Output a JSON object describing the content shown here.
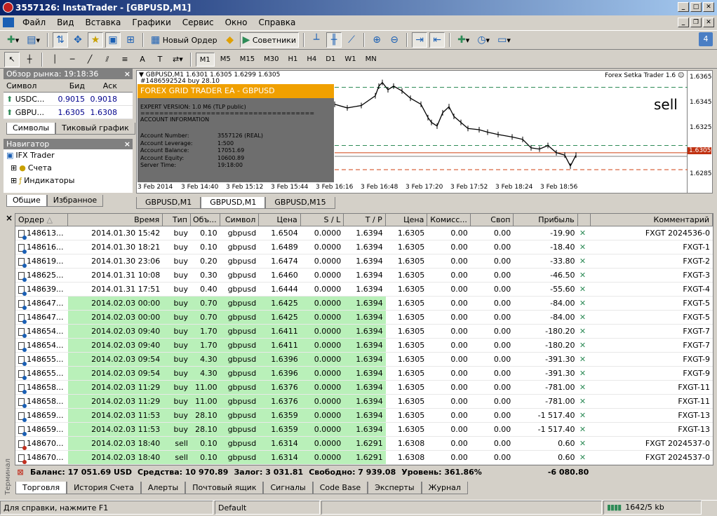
{
  "window": {
    "title": "3557126: InstaTrader - [GBPUSD,M1]"
  },
  "menu": [
    "Файл",
    "Вид",
    "Вставка",
    "Графики",
    "Сервис",
    "Окно",
    "Справка"
  ],
  "toolbar": {
    "new_order": "Новый Ордер",
    "advisors": "Советники"
  },
  "timeframes": [
    "M1",
    "M5",
    "M15",
    "M30",
    "H1",
    "H4",
    "D1",
    "W1",
    "MN"
  ],
  "market_watch": {
    "title": "Обзор рынка: 19:18:36",
    "headers": [
      "Символ",
      "Бид",
      "Аск"
    ],
    "rows": [
      {
        "symbol": "USDC...",
        "bid": "0.9015",
        "ask": "0.9018"
      },
      {
        "symbol": "GBPU...",
        "bid": "1.6305",
        "ask": "1.6308"
      }
    ],
    "tabs": [
      "Символы",
      "Тиковый график"
    ]
  },
  "navigator": {
    "title": "Навигатор",
    "items": [
      "IFX Trader",
      "Счета",
      "Индикаторы"
    ],
    "tabs": [
      "Общие",
      "Избранное"
    ]
  },
  "chart": {
    "header": "GBPUSD,M1  1.6301 1.6305 1.6299 1.6305",
    "order_label": "#1486592524 buy 28.10",
    "ea_name": "Forex Setka Trader 1.6",
    "signal": "sell",
    "price_ticks": [
      "1.6365",
      "1.6345",
      "1.6325",
      "1.6305",
      "1.6285"
    ],
    "current_price": "1.6305",
    "time_ticks": [
      "3 Feb 2014",
      "3 Feb 14:40",
      "3 Feb 15:12",
      "3 Feb 15:44",
      "3 Feb 16:16",
      "3 Feb 16:48",
      "3 Feb 17:20",
      "3 Feb 17:52",
      "3 Feb 18:24",
      "3 Feb 18:56"
    ],
    "overlay": {
      "title": "FOREX GRID TRADER EA - GBPUSD",
      "version": "EXPERT VERSION: 1.0 M6 (TLP public)",
      "divider": "=====================================",
      "section": "ACCOUNT INFORMATION",
      "labels": [
        "Account Number:",
        "Account Leverage:",
        "Account Balance:",
        "Account Equity:",
        "Server Time:"
      ],
      "values": [
        "3557126 (REAL)",
        "1:500",
        "17051.69",
        "10600.89",
        "19:18:00"
      ]
    },
    "tabs": [
      "GBPUSD,M1",
      "GBPUSD,M1",
      "GBPUSD,M15"
    ]
  },
  "terminal": {
    "side_label": "Терминал",
    "headers": [
      "Ордер",
      "Время",
      "Тип",
      "Объ...",
      "Символ",
      "Цена",
      "S / L",
      "T / P",
      "Цена",
      "Комисс...",
      "Своп",
      "Прибыль",
      "Комментарий"
    ],
    "rows": [
      {
        "order": "148613...",
        "time": "2014.01.30 15:42",
        "type": "buy",
        "vol": "0.10",
        "sym": "gbpusd",
        "price": "1.6504",
        "sl": "0.0000",
        "tp": "1.6394",
        "cur": "1.6305",
        "com": "0.00",
        "swap": "0.00",
        "profit": "-19.90",
        "comment": "FXGT 2024536-0",
        "green": false
      },
      {
        "order": "148616...",
        "time": "2014.01.30 18:21",
        "type": "buy",
        "vol": "0.10",
        "sym": "gbpusd",
        "price": "1.6489",
        "sl": "0.0000",
        "tp": "1.6394",
        "cur": "1.6305",
        "com": "0.00",
        "swap": "0.00",
        "profit": "-18.40",
        "comment": "FXGT-1",
        "green": false
      },
      {
        "order": "148619...",
        "time": "2014.01.30 23:06",
        "type": "buy",
        "vol": "0.20",
        "sym": "gbpusd",
        "price": "1.6474",
        "sl": "0.0000",
        "tp": "1.6394",
        "cur": "1.6305",
        "com": "0.00",
        "swap": "0.00",
        "profit": "-33.80",
        "comment": "FXGT-2",
        "green": false
      },
      {
        "order": "148625...",
        "time": "2014.01.31 10:08",
        "type": "buy",
        "vol": "0.30",
        "sym": "gbpusd",
        "price": "1.6460",
        "sl": "0.0000",
        "tp": "1.6394",
        "cur": "1.6305",
        "com": "0.00",
        "swap": "0.00",
        "profit": "-46.50",
        "comment": "FXGT-3",
        "green": false
      },
      {
        "order": "148639...",
        "time": "2014.01.31 17:51",
        "type": "buy",
        "vol": "0.40",
        "sym": "gbpusd",
        "price": "1.6444",
        "sl": "0.0000",
        "tp": "1.6394",
        "cur": "1.6305",
        "com": "0.00",
        "swap": "0.00",
        "profit": "-55.60",
        "comment": "FXGT-4",
        "green": false
      },
      {
        "order": "148647...",
        "time": "2014.02.03 00:00",
        "type": "buy",
        "vol": "0.70",
        "sym": "gbpusd",
        "price": "1.6425",
        "sl": "0.0000",
        "tp": "1.6394",
        "cur": "1.6305",
        "com": "0.00",
        "swap": "0.00",
        "profit": "-84.00",
        "comment": "FXGT-5",
        "green": true
      },
      {
        "order": "148647...",
        "time": "2014.02.03 00:00",
        "type": "buy",
        "vol": "0.70",
        "sym": "gbpusd",
        "price": "1.6425",
        "sl": "0.0000",
        "tp": "1.6394",
        "cur": "1.6305",
        "com": "0.00",
        "swap": "0.00",
        "profit": "-84.00",
        "comment": "FXGT-5",
        "green": true
      },
      {
        "order": "148654...",
        "time": "2014.02.03 09:40",
        "type": "buy",
        "vol": "1.70",
        "sym": "gbpusd",
        "price": "1.6411",
        "sl": "0.0000",
        "tp": "1.6394",
        "cur": "1.6305",
        "com": "0.00",
        "swap": "0.00",
        "profit": "-180.20",
        "comment": "FXGT-7",
        "green": true
      },
      {
        "order": "148654...",
        "time": "2014.02.03 09:40",
        "type": "buy",
        "vol": "1.70",
        "sym": "gbpusd",
        "price": "1.6411",
        "sl": "0.0000",
        "tp": "1.6394",
        "cur": "1.6305",
        "com": "0.00",
        "swap": "0.00",
        "profit": "-180.20",
        "comment": "FXGT-7",
        "green": true
      },
      {
        "order": "148655...",
        "time": "2014.02.03 09:54",
        "type": "buy",
        "vol": "4.30",
        "sym": "gbpusd",
        "price": "1.6396",
        "sl": "0.0000",
        "tp": "1.6394",
        "cur": "1.6305",
        "com": "0.00",
        "swap": "0.00",
        "profit": "-391.30",
        "comment": "FXGT-9",
        "green": true
      },
      {
        "order": "148655...",
        "time": "2014.02.03 09:54",
        "type": "buy",
        "vol": "4.30",
        "sym": "gbpusd",
        "price": "1.6396",
        "sl": "0.0000",
        "tp": "1.6394",
        "cur": "1.6305",
        "com": "0.00",
        "swap": "0.00",
        "profit": "-391.30",
        "comment": "FXGT-9",
        "green": true
      },
      {
        "order": "148658...",
        "time": "2014.02.03 11:29",
        "type": "buy",
        "vol": "11.00",
        "sym": "gbpusd",
        "price": "1.6376",
        "sl": "0.0000",
        "tp": "1.6394",
        "cur": "1.6305",
        "com": "0.00",
        "swap": "0.00",
        "profit": "-781.00",
        "comment": "FXGT-11",
        "green": true
      },
      {
        "order": "148658...",
        "time": "2014.02.03 11:29",
        "type": "buy",
        "vol": "11.00",
        "sym": "gbpusd",
        "price": "1.6376",
        "sl": "0.0000",
        "tp": "1.6394",
        "cur": "1.6305",
        "com": "0.00",
        "swap": "0.00",
        "profit": "-781.00",
        "comment": "FXGT-11",
        "green": true
      },
      {
        "order": "148659...",
        "time": "2014.02.03 11:53",
        "type": "buy",
        "vol": "28.10",
        "sym": "gbpusd",
        "price": "1.6359",
        "sl": "0.0000",
        "tp": "1.6394",
        "cur": "1.6305",
        "com": "0.00",
        "swap": "0.00",
        "profit": "-1 517.40",
        "comment": "FXGT-13",
        "green": true
      },
      {
        "order": "148659...",
        "time": "2014.02.03 11:53",
        "type": "buy",
        "vol": "28.10",
        "sym": "gbpusd",
        "price": "1.6359",
        "sl": "0.0000",
        "tp": "1.6394",
        "cur": "1.6305",
        "com": "0.00",
        "swap": "0.00",
        "profit": "-1 517.40",
        "comment": "FXGT-13",
        "green": true
      },
      {
        "order": "148670...",
        "time": "2014.02.03 18:40",
        "type": "sell",
        "vol": "0.10",
        "sym": "gbpusd",
        "price": "1.6314",
        "sl": "0.0000",
        "tp": "1.6291",
        "cur": "1.6308",
        "com": "0.00",
        "swap": "0.00",
        "profit": "0.60",
        "comment": "FXGT 2024537-0",
        "green": true
      },
      {
        "order": "148670...",
        "time": "2014.02.03 18:40",
        "type": "sell",
        "vol": "0.10",
        "sym": "gbpusd",
        "price": "1.6314",
        "sl": "0.0000",
        "tp": "1.6291",
        "cur": "1.6308",
        "com": "0.00",
        "swap": "0.00",
        "profit": "0.60",
        "comment": "FXGT 2024537-0",
        "green": true
      }
    ],
    "summary": {
      "balance": "Баланс: 17 051.69 USD",
      "equity": "Средства: 10 970.89",
      "margin": "Залог: 3 031.81",
      "free": "Свободно: 7 939.08",
      "level": "Уровень: 361.86%",
      "total": "-6 080.80"
    },
    "tabs": [
      "Торговля",
      "История Счета",
      "Алерты",
      "Почтовый ящик",
      "Сигналы",
      "Code Base",
      "Эксперты",
      "Журнал"
    ]
  },
  "statusbar": {
    "help": "Для справки, нажмите F1",
    "profile": "Default",
    "traffic": "1642/5 kb"
  },
  "notification_count": "4",
  "colors": {
    "titlebar": "#0a246a",
    "green_row": "#b9f0b9",
    "overlay_header": "#f0a000",
    "current_price": "#d04010"
  }
}
